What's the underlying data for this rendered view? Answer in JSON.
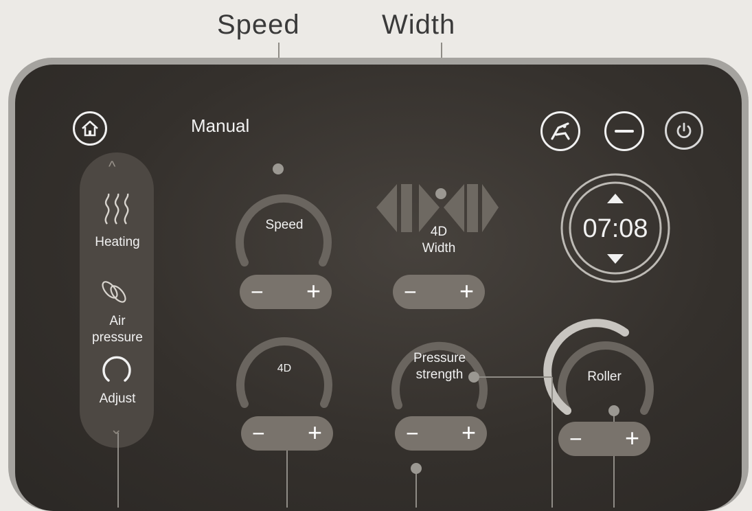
{
  "callouts": {
    "speed": "Speed",
    "width": "Width"
  },
  "header": {
    "title": "Manual"
  },
  "sidebar": {
    "items": [
      {
        "label": "Heating",
        "icon": "heating-waves-icon"
      },
      {
        "label": "Air\npressure",
        "icon": "air-pressure-icon"
      },
      {
        "label": "Adjust",
        "icon": "adjust-ring-icon"
      }
    ]
  },
  "controls": {
    "speed_label": "Speed",
    "width_label": "4D\nWidth",
    "fourd_label": "4D",
    "pressure_label": "Pressure\nstrength",
    "roller_label": "Roller",
    "minus": "−",
    "plus": "+"
  },
  "timer": {
    "value": "07:08"
  },
  "icons": {
    "home": "home-icon",
    "recline": "recline-chair-icon",
    "minimize": "minus-circle-icon",
    "power": "power-icon"
  },
  "colors": {
    "panel": "#34302c",
    "track": "#6a655f",
    "text": "#f1f1f1",
    "power_accent": "#d9d9d9"
  }
}
